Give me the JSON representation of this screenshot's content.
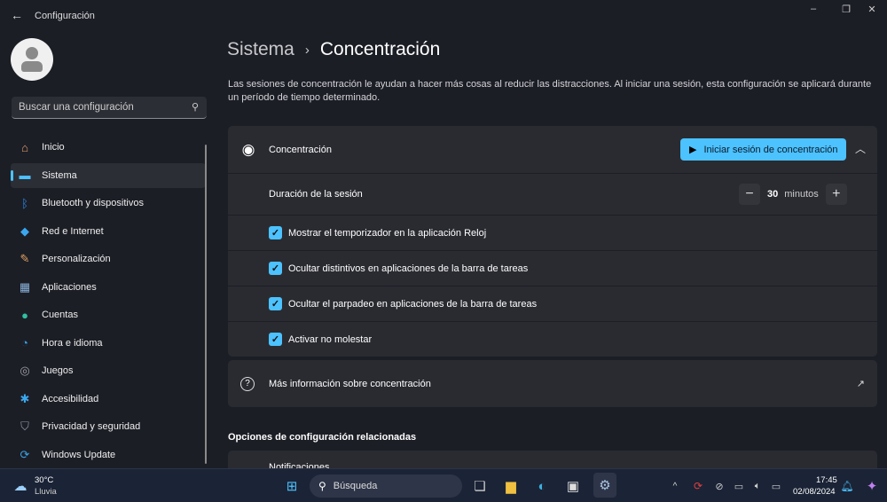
{
  "window": {
    "title": "Configuración",
    "back": "←",
    "minimize": "–",
    "maximize": "❐",
    "close": "✕"
  },
  "search": {
    "placeholder": "Buscar una configuración"
  },
  "sidebar": {
    "items": [
      {
        "label": "Inicio",
        "icon": "home-icon",
        "glyph": "⌂",
        "color": "#e8a070"
      },
      {
        "label": "Sistema",
        "icon": "system-icon",
        "glyph": "▬",
        "color": "#4cc2ff",
        "selected": true
      },
      {
        "label": "Bluetooth y dispositivos",
        "icon": "bluetooth-icon",
        "glyph": "ᛒ",
        "color": "#2a8cf0"
      },
      {
        "label": "Red e Internet",
        "icon": "wifi-icon",
        "glyph": "◆",
        "color": "#3aa8f0"
      },
      {
        "label": "Personalización",
        "icon": "brush-icon",
        "glyph": "✎",
        "color": "#e0a060"
      },
      {
        "label": "Aplicaciones",
        "icon": "apps-icon",
        "glyph": "▦",
        "color": "#8ab0d8"
      },
      {
        "label": "Cuentas",
        "icon": "account-icon",
        "glyph": "●",
        "color": "#30c0a0"
      },
      {
        "label": "Hora e idioma",
        "icon": "clock-globe-icon",
        "glyph": "◔",
        "color": "#3aa0e0"
      },
      {
        "label": "Juegos",
        "icon": "gamepad-icon",
        "glyph": "◎",
        "color": "#a0a0a8"
      },
      {
        "label": "Accesibilidad",
        "icon": "accessibility-icon",
        "glyph": "✱",
        "color": "#3aa8f0"
      },
      {
        "label": "Privacidad y seguridad",
        "icon": "shield-icon",
        "glyph": "⛉",
        "color": "#9098a8"
      },
      {
        "label": "Windows Update",
        "icon": "update-icon",
        "glyph": "⟳",
        "color": "#3aa0e0"
      }
    ]
  },
  "breadcrumb": {
    "parent": "Sistema",
    "separator": "›",
    "current": "Concentración"
  },
  "description": "Las sesiones de concentración le ayudan a hacer más cosas al reducir las distracciones. Al iniciar una sesión, esta configuración se aplicará durante un período de tiempo determinado.",
  "focus": {
    "title": "Concentración",
    "start_label": "Iniciar sesión de concentración",
    "duration_label": "Duración de la sesión",
    "duration_value": "30",
    "duration_unit": "minutos",
    "options": [
      {
        "label": "Mostrar el temporizador en la aplicación Reloj",
        "checked": true
      },
      {
        "label": "Ocultar distintivos en aplicaciones de la barra de tareas",
        "checked": true
      },
      {
        "label": "Ocultar el parpadeo en aplicaciones de la barra de tareas",
        "checked": true
      },
      {
        "label": "Activar no molestar",
        "checked": true
      }
    ]
  },
  "more_info": "Más información sobre concentración",
  "related": {
    "title": "Opciones de configuración relacionadas",
    "items": [
      "Notificaciones"
    ]
  },
  "taskbar": {
    "weather_temp": "30°C",
    "weather_desc": "Lluvia",
    "search_label": "Búsqueda",
    "time": "17:45",
    "date": "02/08/2024"
  },
  "colors": {
    "accent": "#4cc2ff",
    "background": "#1c1e26",
    "card": "#2a2b31"
  }
}
